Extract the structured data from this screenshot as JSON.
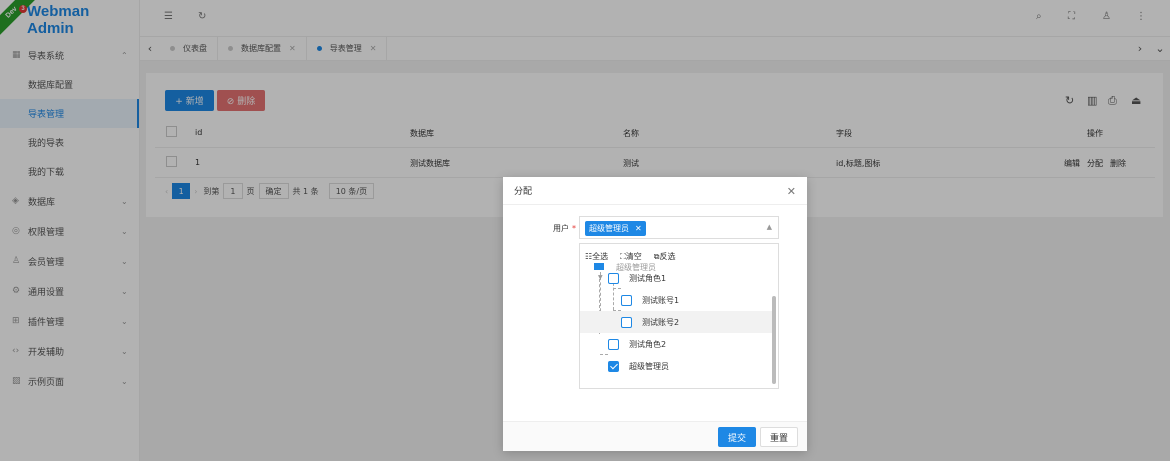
{
  "app": {
    "title": "Webman Admin",
    "env_badge": "Dev",
    "env_count": "3"
  },
  "sidebar": {
    "groups": [
      {
        "label": "导表系统",
        "icon": "grid-icon",
        "expanded": true,
        "items": [
          {
            "label": "数据库配置",
            "active": false
          },
          {
            "label": "导表管理",
            "active": true
          },
          {
            "label": "我的导表",
            "active": false
          },
          {
            "label": "我的下载",
            "active": false
          }
        ]
      },
      {
        "label": "数据库",
        "icon": "database-icon",
        "expanded": false
      },
      {
        "label": "权限管理",
        "icon": "shield-icon",
        "expanded": false
      },
      {
        "label": "会员管理",
        "icon": "user-icon",
        "expanded": false
      },
      {
        "label": "通用设置",
        "icon": "gear-icon",
        "expanded": false
      },
      {
        "label": "插件管理",
        "icon": "plugin-icon",
        "expanded": false
      },
      {
        "label": "开发辅助",
        "icon": "code-icon",
        "expanded": false
      },
      {
        "label": "示例页面",
        "icon": "image-icon",
        "expanded": false
      }
    ]
  },
  "tabs": [
    {
      "label": "仪表盘",
      "active": false
    },
    {
      "label": "数据库配置",
      "active": false
    },
    {
      "label": "导表管理",
      "active": true
    }
  ],
  "toolbar": {
    "new_label": "+ 新增",
    "delete_label": "⊘ 删除"
  },
  "table": {
    "headers": [
      "id",
      "数据库",
      "名称",
      "字段",
      "操作"
    ],
    "rows": [
      {
        "id": "1",
        "database": "测试数据库",
        "name": "测试",
        "fields": "id,标题,图标",
        "actions": [
          "编辑",
          "分配",
          "删除"
        ]
      }
    ]
  },
  "pager": {
    "current_page": "1",
    "goto_label": "到第",
    "goto_value": "1",
    "page_unit": "页",
    "confirm_label": "确定",
    "total": "共 1 条",
    "page_size": "10 条/页"
  },
  "modal": {
    "title": "分配",
    "user_label": "用户",
    "required_mark": "*",
    "selected_chip": "超级管理员",
    "tools": {
      "select_all": "全选",
      "clear": "清空",
      "invert": "反选"
    },
    "partial_label": "超级管理员",
    "tree": [
      {
        "label": "测试角色1",
        "level": 1,
        "checked": false,
        "highlight": false
      },
      {
        "label": "测试账号1",
        "level": 2,
        "checked": false,
        "highlight": false
      },
      {
        "label": "测试账号2",
        "level": 2,
        "checked": false,
        "highlight": true
      },
      {
        "label": "测试角色2",
        "level": 1,
        "checked": false,
        "highlight": false
      },
      {
        "label": "超级管理员",
        "level": 1,
        "checked": true,
        "highlight": false
      }
    ],
    "submit_label": "提交",
    "reset_label": "重置"
  },
  "colors": {
    "primary": "#1e88e5",
    "danger": "#e57373",
    "dev_badge": "#2ca02c"
  }
}
